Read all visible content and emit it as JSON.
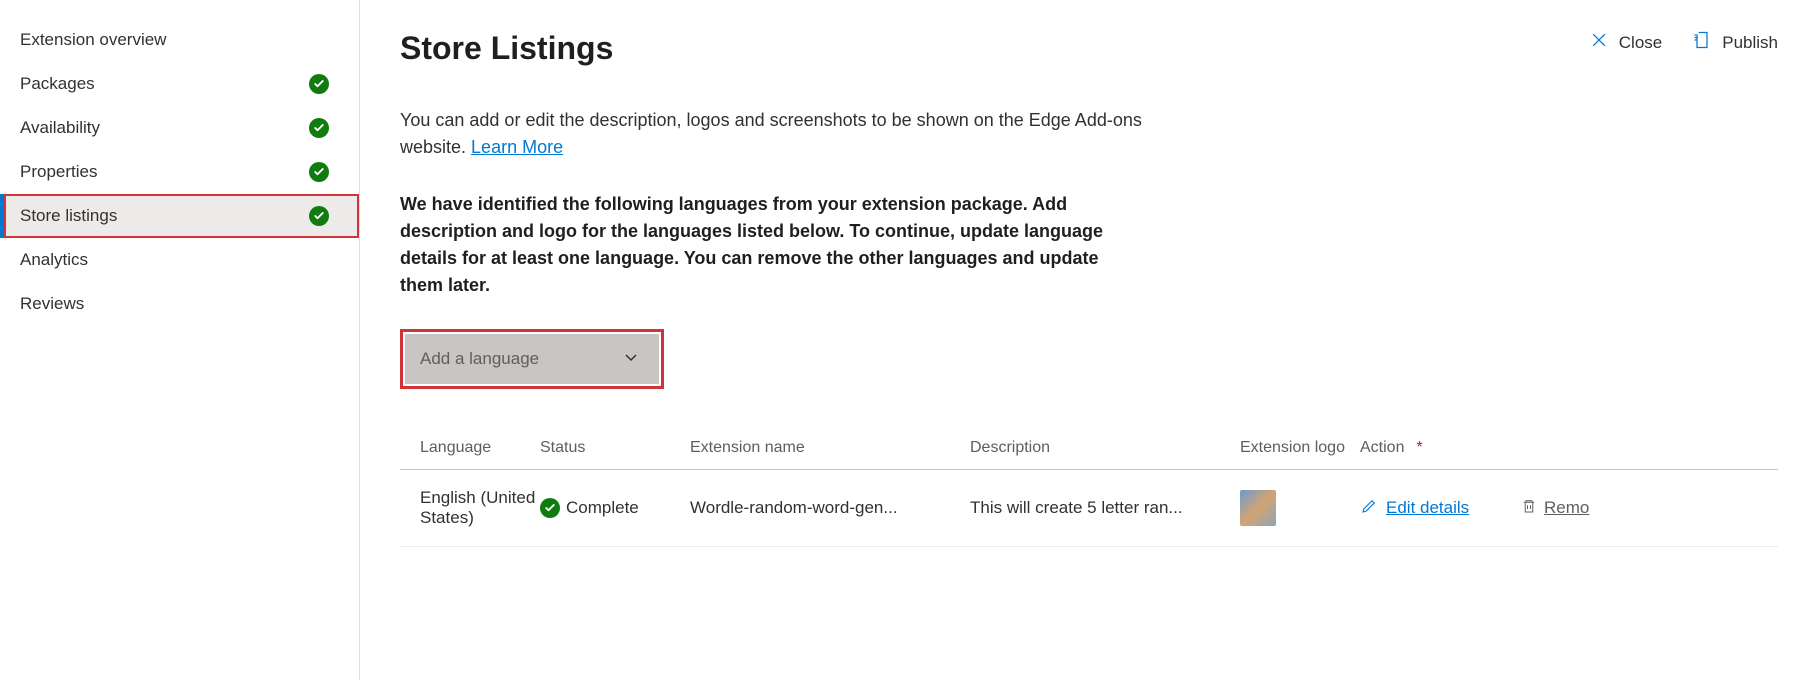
{
  "sidebar": {
    "items": [
      {
        "label": "Extension overview",
        "complete": false,
        "active": false
      },
      {
        "label": "Packages",
        "complete": true,
        "active": false
      },
      {
        "label": "Availability",
        "complete": true,
        "active": false
      },
      {
        "label": "Properties",
        "complete": true,
        "active": false
      },
      {
        "label": "Store listings",
        "complete": true,
        "active": true,
        "highlighted": true
      },
      {
        "label": "Analytics",
        "complete": false,
        "active": false
      },
      {
        "label": "Reviews",
        "complete": false,
        "active": false
      }
    ]
  },
  "header": {
    "title": "Store Listings",
    "close_label": "Close",
    "publish_label": "Publish"
  },
  "main": {
    "description_prefix": "You can add or edit the description, logos and screenshots to be shown on the Edge Add-ons website. ",
    "learn_more": "Learn More",
    "instructions": "We have identified the following languages from your extension package. Add description and logo for the languages listed below. To continue, update language details for at least one language. You can remove the other languages and update them later.",
    "dropdown_label": "Add a language"
  },
  "table": {
    "headers": {
      "language": "Language",
      "status": "Status",
      "extension_name": "Extension name",
      "description": "Description",
      "extension_logo": "Extension logo",
      "action": "Action"
    },
    "rows": [
      {
        "language": "English (United States)",
        "status": "Complete",
        "extension_name": "Wordle-random-word-gen...",
        "description": "This will create 5 letter ran...",
        "edit_label": "Edit details",
        "remove_label": "Remo"
      }
    ]
  }
}
